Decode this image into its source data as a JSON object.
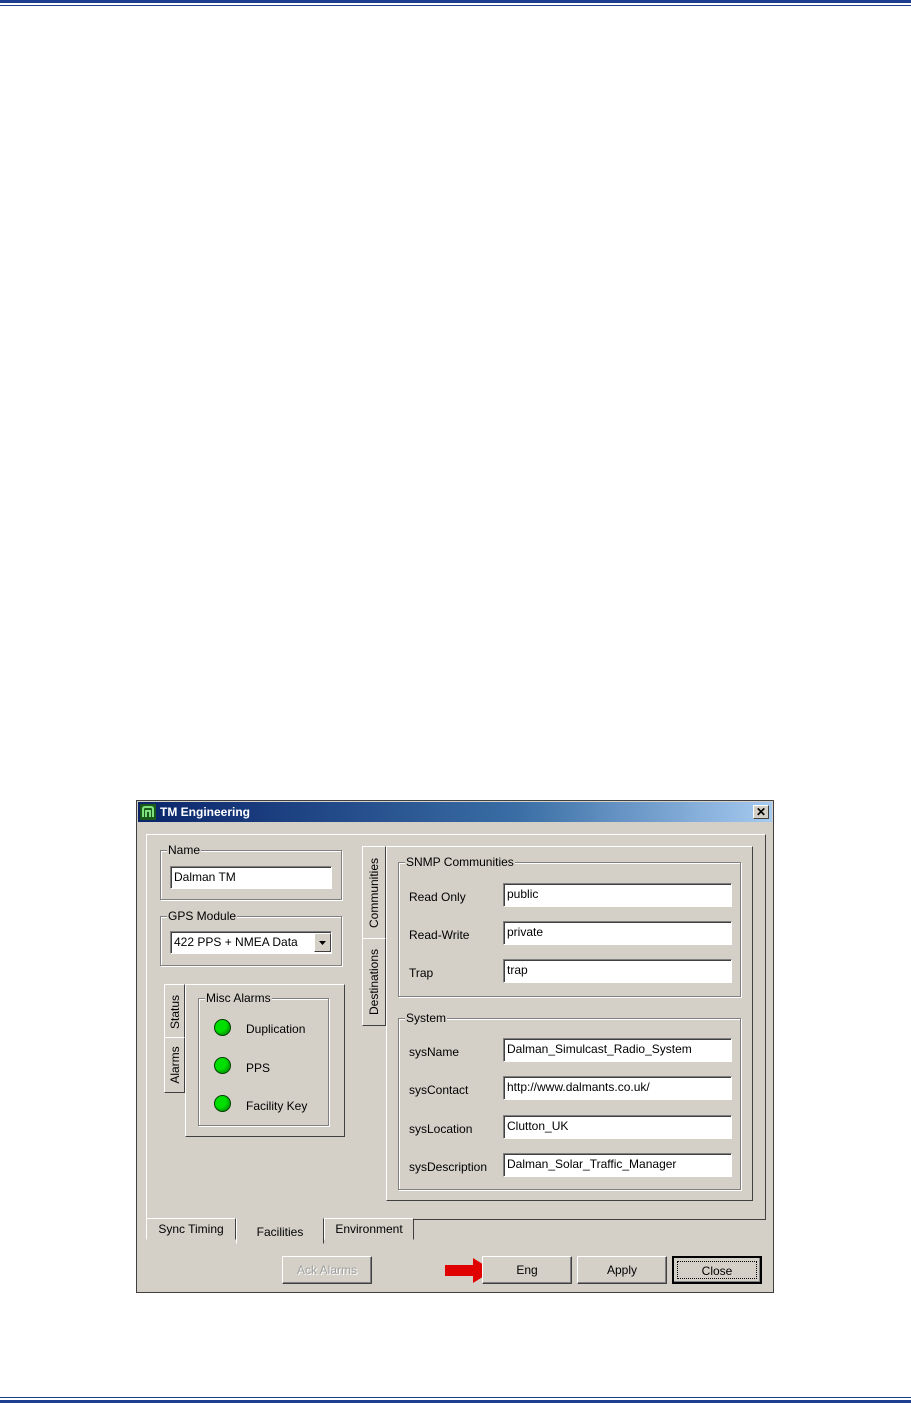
{
  "window": {
    "title": "TM Engineering",
    "close_glyph": "✕"
  },
  "name_group": {
    "legend": "Name",
    "value": "Dalman TM"
  },
  "gps_group": {
    "legend": "GPS Module",
    "selected": "422 PPS + NMEA Data"
  },
  "left_tabs": {
    "status": "Status",
    "alarms": "Alarms"
  },
  "misc_alarms": {
    "legend": "Misc Alarms",
    "items": [
      {
        "label": "Duplication",
        "color": "#00e000"
      },
      {
        "label": "PPS",
        "color": "#00e000"
      },
      {
        "label": "Facility Key",
        "color": "#00e000"
      }
    ]
  },
  "right_tabs": {
    "communities": "Communities",
    "destinations": "Destinations"
  },
  "snmp": {
    "legend": "SNMP Communities",
    "rows": [
      {
        "label": "Read Only",
        "value": "public"
      },
      {
        "label": "Read-Write",
        "value": "private"
      },
      {
        "label": "Trap",
        "value": "trap"
      }
    ]
  },
  "system": {
    "legend": "System",
    "rows": [
      {
        "label": "sysName",
        "value": "Dalman_Simulcast_Radio_System"
      },
      {
        "label": "sysContact",
        "value": "http://www.dalmants.co.uk/"
      },
      {
        "label": "sysLocation",
        "value": "Clutton_UK"
      },
      {
        "label": "sysDescription",
        "value": "Dalman_Solar_Traffic_Manager"
      }
    ]
  },
  "bottom_tabs": {
    "sync": "Sync Timing",
    "facilities": "Facilities",
    "environment": "Environment"
  },
  "buttons": {
    "ack": "Ack Alarms",
    "eng": "Eng",
    "apply": "Apply",
    "close": "Close"
  },
  "colors": {
    "arrow": "#e00000",
    "rule": "#1e3f8f"
  }
}
